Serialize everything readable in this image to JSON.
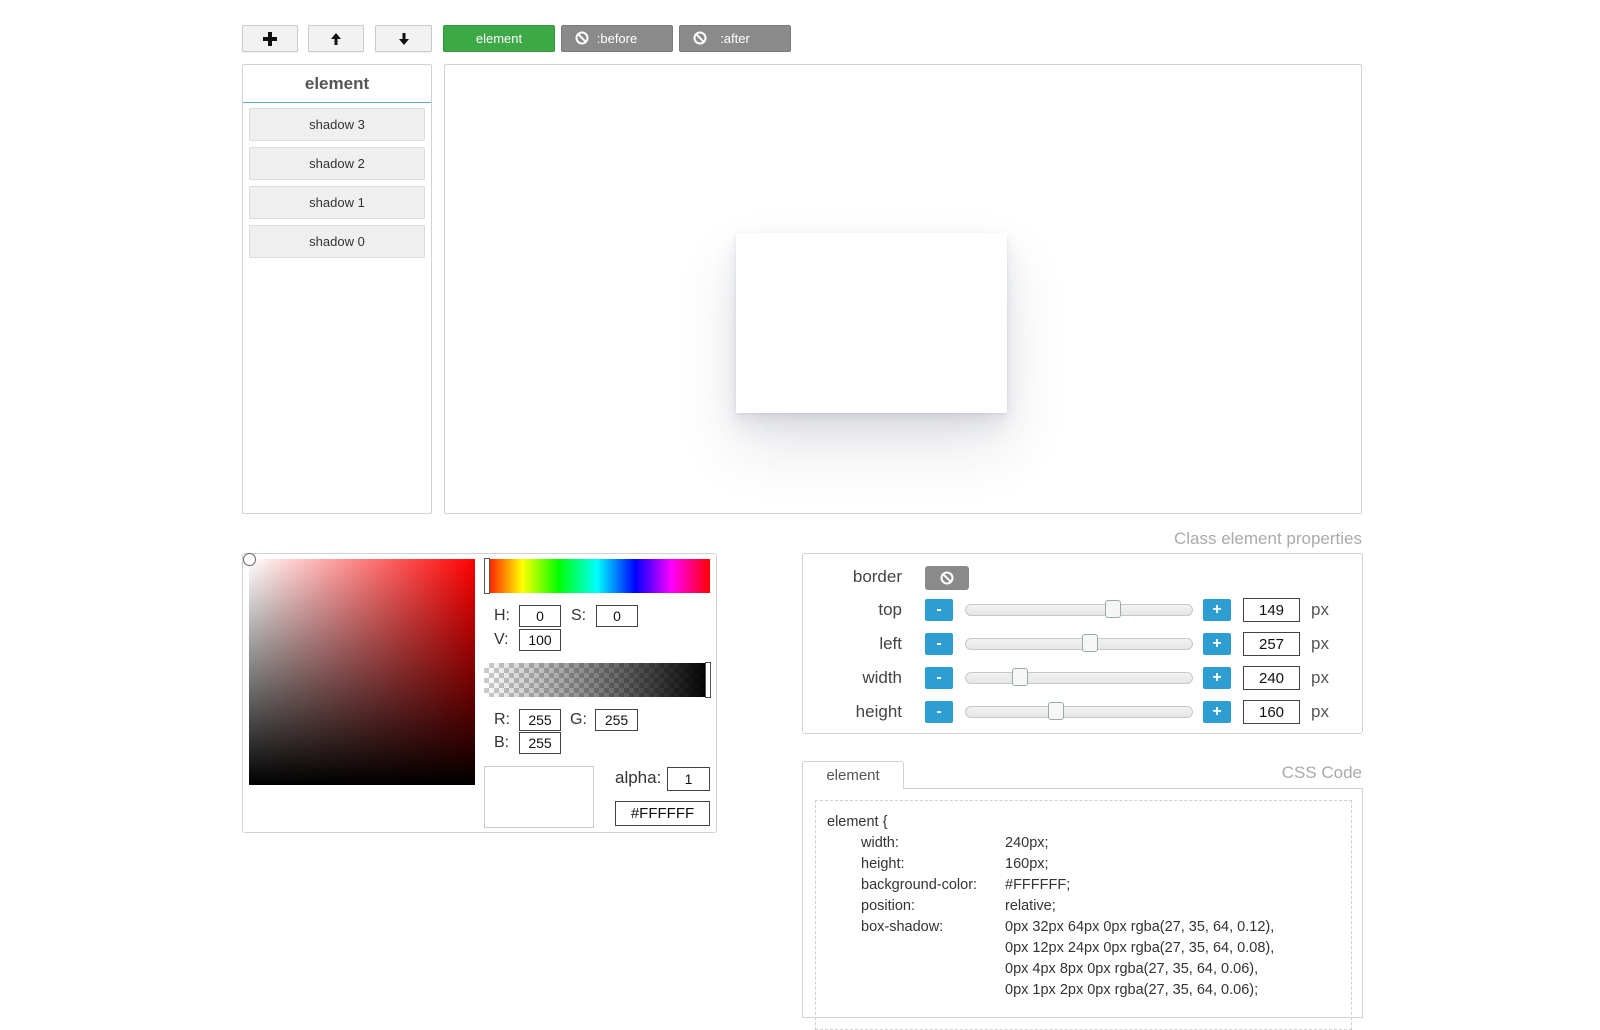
{
  "toolbar": {
    "add_icon": "plus-icon",
    "up_icon": "arrow-up-icon",
    "down_icon": "arrow-down-icon",
    "tabs": [
      {
        "label": "element",
        "state": "active"
      },
      {
        "label": ":before",
        "state": "disabled"
      },
      {
        "label": ":after",
        "state": "disabled"
      }
    ]
  },
  "layers": {
    "title": "element",
    "items": [
      "shadow 3",
      "shadow 2",
      "shadow 1",
      "shadow 0"
    ]
  },
  "color_picker": {
    "h_label": "H:",
    "h": "0",
    "s_label": "S:",
    "s": "0",
    "v_label": "V:",
    "v": "100",
    "r_label": "R:",
    "r": "255",
    "g_label": "G:",
    "g": "255",
    "b_label": "B:",
    "b": "255",
    "alpha_label": "alpha:",
    "alpha": "1",
    "hex": "#FFFFFF"
  },
  "properties": {
    "caption": "Class element properties",
    "border_label": "border",
    "minus": "-",
    "plus": "+",
    "rows": [
      {
        "label": "top",
        "value": "149",
        "unit": "px",
        "slider_fraction": 0.65
      },
      {
        "label": "left",
        "value": "257",
        "unit": "px",
        "slider_fraction": 0.55
      },
      {
        "label": "width",
        "value": "240",
        "unit": "px",
        "slider_fraction": 0.24
      },
      {
        "label": "height",
        "value": "160",
        "unit": "px",
        "slider_fraction": 0.4
      }
    ]
  },
  "css_code": {
    "caption": "CSS Code",
    "tab": "element",
    "selector": "element {",
    "declarations": [
      {
        "prop": "width:",
        "value": "240px;"
      },
      {
        "prop": "height:",
        "value": "160px;"
      },
      {
        "prop": "background-color:",
        "value": "#FFFFFF;"
      },
      {
        "prop": "position:",
        "value": "relative;"
      },
      {
        "prop": "box-shadow:",
        "value": "0px 32px 64px 0px rgba(27, 35, 64, 0.12),"
      }
    ],
    "box_shadow_continued": [
      "0px 12px 24px 0px rgba(27, 35, 64, 0.08),",
      "0px 4px 8px 0px rgba(27, 35, 64, 0.06),",
      "0px 1px 2px 0px rgba(27, 35, 64, 0.06);"
    ]
  },
  "colors": {
    "active_tab": "#3da846",
    "disabled_tab": "#8a8a8a",
    "step_button": "#2e9dd1",
    "preview_fill": "#FFFFFF"
  }
}
